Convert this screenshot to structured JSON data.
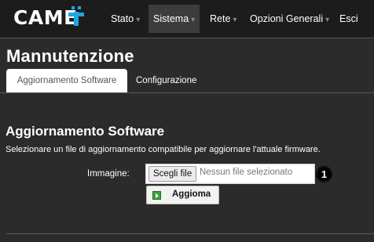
{
  "brand": {
    "name": "CAME"
  },
  "nav": {
    "items": [
      {
        "label": "Stato",
        "caret": "▾"
      },
      {
        "label": "Sistema",
        "caret": "▾"
      },
      {
        "label": "Rete",
        "caret": "▾"
      },
      {
        "label": "Opzioni Generali",
        "caret": "▾"
      },
      {
        "label": "Esci"
      }
    ],
    "active": "Sistema"
  },
  "page": {
    "title": "Mannutenzione"
  },
  "tabs": [
    {
      "label": "Aggiornamento Software",
      "active": true
    },
    {
      "label": "Configurazione",
      "active": false
    }
  ],
  "section": {
    "title": "Aggiornamento Software",
    "description": "Selezionare un file di aggiornamento compatibile per aggiornare l'attuale firmware."
  },
  "form": {
    "image_label": "Immagine:",
    "choose_button": "Scegli file",
    "no_file_text": "Nessun file selezionato",
    "update_button": "Aggioma"
  },
  "callout": {
    "number": "1"
  },
  "colors": {
    "background": "#2b2b2b",
    "topbar": "#1c1c1c",
    "brand_accent": "#1ea7e1",
    "update_icon": "#3aa33a"
  }
}
